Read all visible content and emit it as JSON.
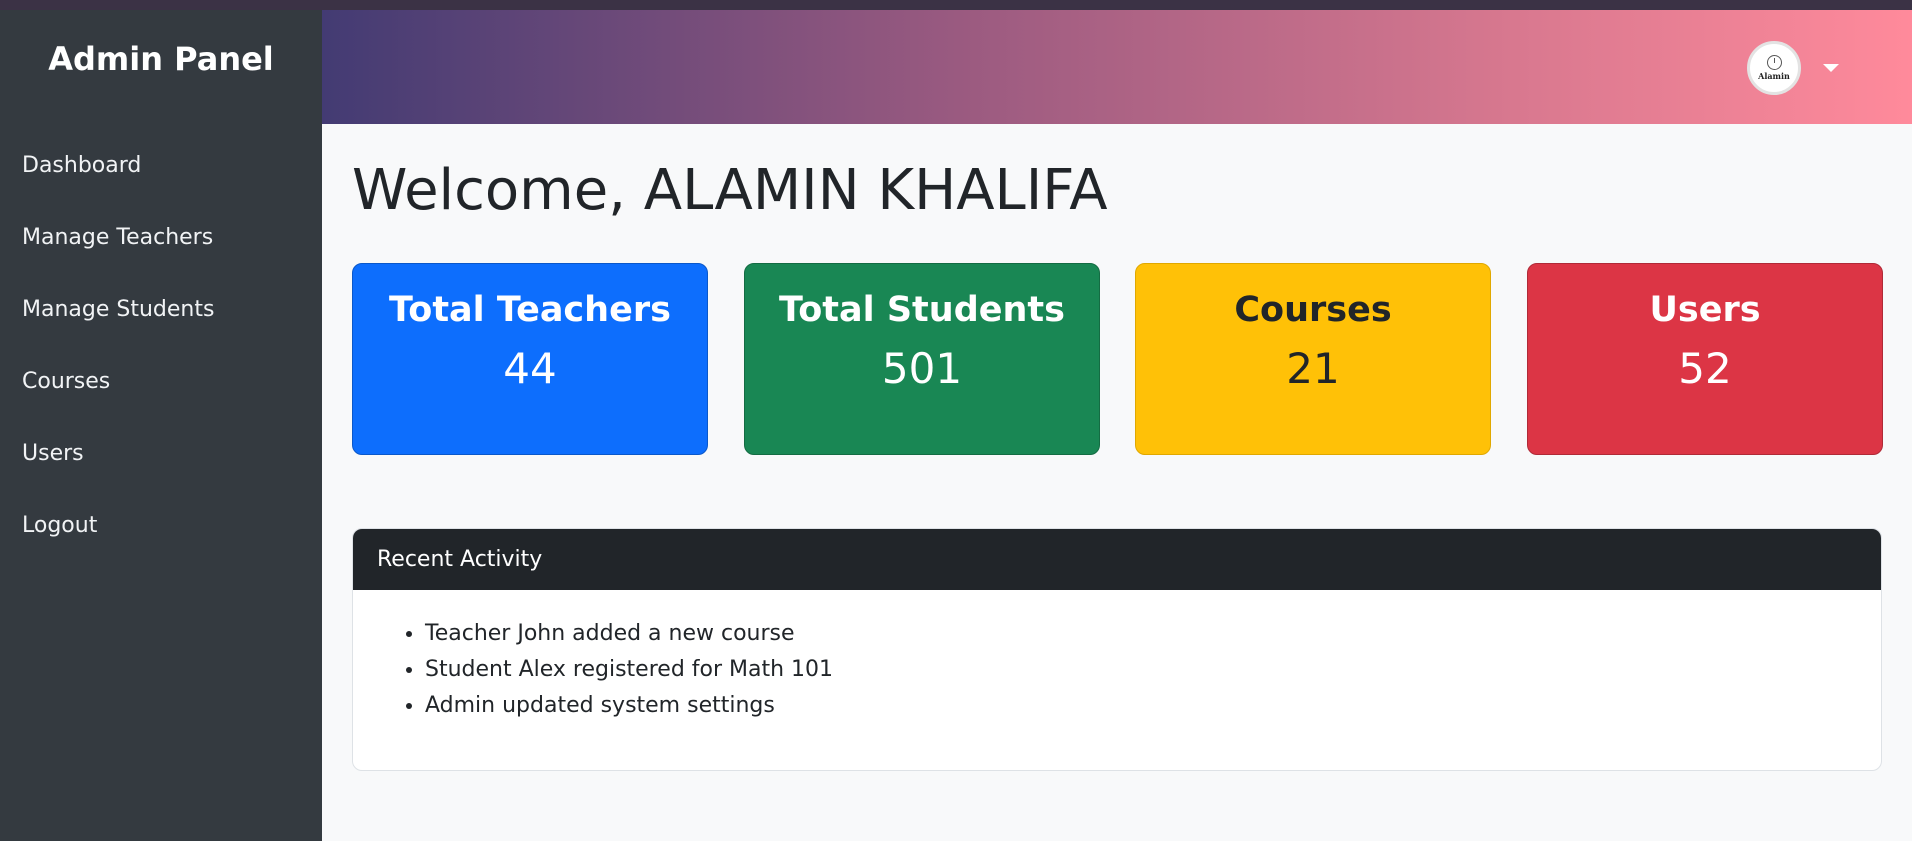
{
  "sidebar": {
    "brand": "Admin Panel",
    "items": [
      {
        "label": "Dashboard"
      },
      {
        "label": "Manage Teachers"
      },
      {
        "label": "Manage Students"
      },
      {
        "label": "Courses"
      },
      {
        "label": "Users"
      },
      {
        "label": "Logout"
      }
    ]
  },
  "header": {
    "gradient": [
      "#433b73",
      "#ff8a9b"
    ],
    "avatar_text": "Alamin",
    "dropdown_icon": "caret-down-icon"
  },
  "main": {
    "welcome": "Welcome, ALAMIN KHALIFA",
    "cards": [
      {
        "title": "Total Teachers",
        "value": "44",
        "color": "#0d6efd"
      },
      {
        "title": "Total Students",
        "value": "501",
        "color": "#198754"
      },
      {
        "title": "Courses",
        "value": "21",
        "color": "#ffc107"
      },
      {
        "title": "Users",
        "value": "52",
        "color": "#dc3545"
      }
    ],
    "activity": {
      "title": "Recent Activity",
      "items": [
        "Teacher John added a new course",
        "Student Alex registered for Math 101",
        "Admin updated system settings"
      ]
    }
  }
}
